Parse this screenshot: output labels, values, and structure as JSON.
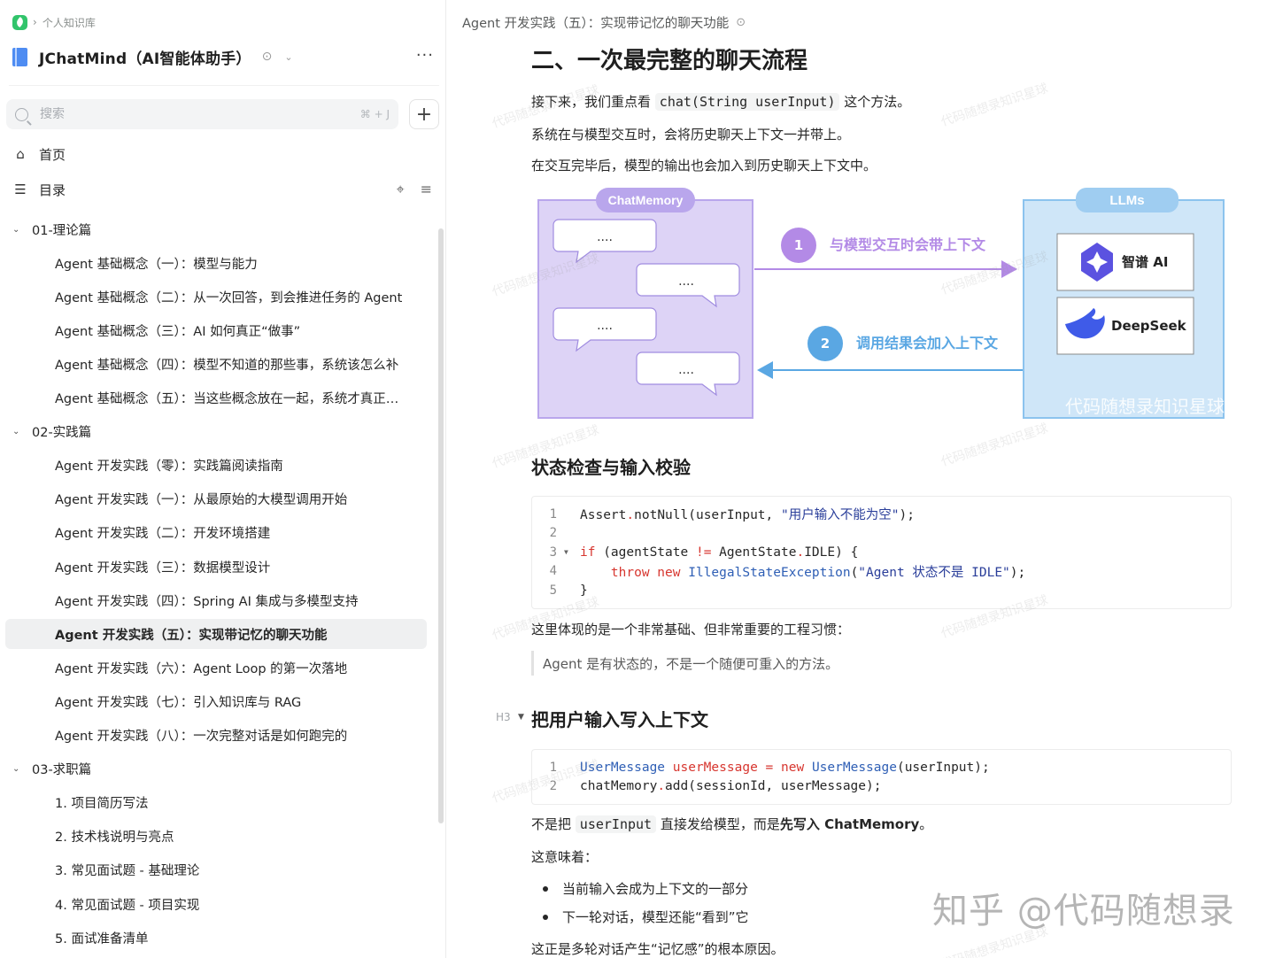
{
  "breadcrumb": {
    "label": "个人知识库"
  },
  "knowledge_base": {
    "title": "JChatMind（AI智能体助手）"
  },
  "search": {
    "placeholder": "搜索",
    "shortcut": "⌘ + J"
  },
  "nav": {
    "home": "首页",
    "toc": "目录"
  },
  "tree": [
    {
      "type": "group",
      "label": "01-理论篇"
    },
    {
      "type": "leaf",
      "label": "Agent 基础概念（一）：模型与能力"
    },
    {
      "type": "leaf",
      "label": "Agent 基础概念（二）：从一次回答，到会推进任务的 Agent"
    },
    {
      "type": "leaf",
      "label": "Agent 基础概念（三）：AI 如何真正“做事”"
    },
    {
      "type": "leaf",
      "label": "Agent 基础概念（四）：模型不知道的那些事，系统该怎么补"
    },
    {
      "type": "leaf",
      "label": "Agent 基础概念（五）：当这些概念放在一起，系统才真正…"
    },
    {
      "type": "group",
      "label": "02-实践篇"
    },
    {
      "type": "leaf",
      "label": "Agent 开发实践（零）：实践篇阅读指南"
    },
    {
      "type": "leaf",
      "label": "Agent 开发实践（一）：从最原始的大模型调用开始"
    },
    {
      "type": "leaf",
      "label": "Agent 开发实践（二）：开发环境搭建"
    },
    {
      "type": "leaf",
      "label": "Agent 开发实践（三）：数据模型设计"
    },
    {
      "type": "leaf",
      "label": "Agent 开发实践（四）：Spring AI 集成与多模型支持"
    },
    {
      "type": "leaf",
      "label": "Agent 开发实践（五）：实现带记忆的聊天功能",
      "active": true
    },
    {
      "type": "leaf",
      "label": "Agent 开发实践（六）：Agent Loop 的第一次落地"
    },
    {
      "type": "leaf",
      "label": "Agent 开发实践（七）：引入知识库与 RAG"
    },
    {
      "type": "leaf",
      "label": "Agent 开发实践（八）：一次完整对话是如何跑完的"
    },
    {
      "type": "group",
      "label": "03-求职篇"
    },
    {
      "type": "leaf",
      "label": "1. 项目简历写法"
    },
    {
      "type": "leaf",
      "label": "2. 技术栈说明与亮点"
    },
    {
      "type": "leaf",
      "label": "3. 常见面试题 - 基础理论"
    },
    {
      "type": "leaf",
      "label": "4. 常见面试题 - 项目实现"
    },
    {
      "type": "leaf",
      "label": "5. 面试准备清单"
    }
  ],
  "doc": {
    "title": "Agent 开发实践（五）：实现带记忆的聊天功能",
    "h2": "二、一次最完整的聊天流程",
    "p1_pre": "接下来，我们重点看",
    "p1_code": "chat(String userInput)",
    "p1_post": "这个方法。",
    "p2": "系统在与模型交互时，会将历史聊天上下文一并带上。",
    "p3": "在交互完毕后，模型的输出也会加入到历史聊天上下文中。",
    "h3_state": "状态检查与输入校验",
    "p4": "这里体现的是一个非常基础、但非常重要的工程习惯：",
    "quote": "Agent 是有状态的，不是一个随便可重入的方法。",
    "h3_tag": "H3",
    "h3_write": "把用户输入写入上下文",
    "p5_pre": "不是把",
    "p5_code": "userInput",
    "p5_mid": "直接发给模型，而是",
    "p5_bold": "先写入 ChatMemory",
    "p5_post": "。",
    "p6": "这意味着：",
    "bullets": [
      "当前输入会成为上下文的一部分",
      "下一轮对话，模型还能“看到”它"
    ],
    "p7": "这正是多轮对话产生“记忆感”的根本原因。"
  },
  "diagram": {
    "memory_label": "ChatMemory",
    "llms_label": "LLMs",
    "bubble_text": "....",
    "step1_num": "1",
    "step1_text": "与模型交互时会带上下文",
    "step2_num": "2",
    "step2_text": "调用结果会加入上下文",
    "model1": "智谱 AI",
    "model2": "DeepSeek",
    "watermark": "代码随想录知识星球",
    "colors": {
      "memory_fill": "#ddd3f6",
      "memory_border": "#b9a6ec",
      "llm_fill": "#cfe6f8",
      "llm_border": "#8cc3ee",
      "step1": "#b38ae6",
      "step2": "#5aa7e3"
    }
  },
  "watermark_text": "代码随想录知识星球",
  "zhihu_mark": "知乎 @代码随想录"
}
